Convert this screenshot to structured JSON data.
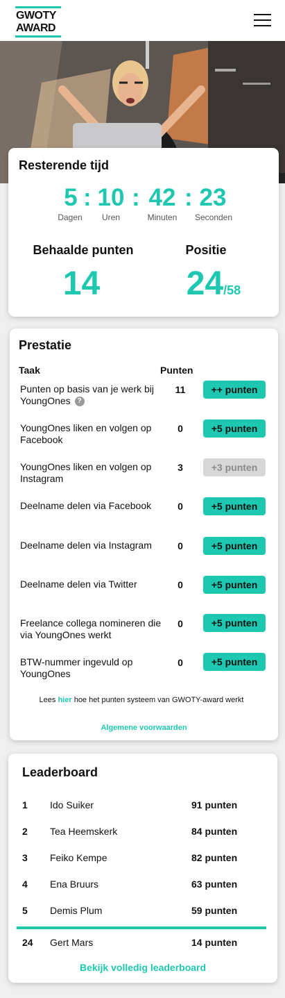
{
  "header": {
    "logo_line1": "GWOTY",
    "logo_line2": "AWARD",
    "menu_icon": "hamburger-icon"
  },
  "colors": {
    "accent": "#1ec8b0",
    "disabled": "#d7d7d7",
    "background": "#efefef"
  },
  "countdown": {
    "title": "Resterende tijd",
    "days": "5",
    "days_label": "Dagen",
    "hours": "10",
    "hours_label": "Uren",
    "minutes": "42",
    "minutes_label": "Minuten",
    "seconds": "23",
    "seconds_label": "Seconden",
    "separator": ":"
  },
  "stats": {
    "points_label": "Behaalde punten",
    "points_value": "14",
    "position_label": "Positie",
    "position_value": "24",
    "position_total": "/58"
  },
  "prestatie": {
    "title": "Prestatie",
    "col_task": "Taak",
    "col_points": "Punten",
    "help_icon": "question-circle-icon",
    "tasks": [
      {
        "label": "Punten op basis van je werk bij YoungOnes",
        "points": "11",
        "button": "++ punten",
        "enabled": true,
        "has_help": true
      },
      {
        "label": "YoungOnes liken en volgen op Facebook",
        "points": "0",
        "button": "+5 punten",
        "enabled": true
      },
      {
        "label": "YoungOnes liken en volgen op Instagram",
        "points": "3",
        "button": "+3 punten",
        "enabled": false
      },
      {
        "label": "Deelname delen via Facebook",
        "points": "0",
        "button": "+5 punten",
        "enabled": true
      },
      {
        "label": "Deelname delen via Instagram",
        "points": "0",
        "button": "+5 punten",
        "enabled": true
      },
      {
        "label": "Deelname delen via Twitter",
        "points": "0",
        "button": "+5 punten",
        "enabled": true
      },
      {
        "label": "Freelance collega nomineren die via YoungOnes werkt",
        "points": "0",
        "button": "+5 punten",
        "enabled": true
      },
      {
        "label": "BTW-nummer ingevuld op YoungOnes",
        "points": "0",
        "button": "+5 punten",
        "enabled": true
      }
    ],
    "footnote_before": "Lees ",
    "footnote_link": "hier",
    "footnote_after": " hoe het punten systeem van GWOTY-award werkt",
    "terms_link": "Algemene voorwaarden"
  },
  "leaderboard": {
    "title": "Leaderboard",
    "rows": [
      {
        "rank": "1",
        "name": "Ido Suiker",
        "points": "91 punten"
      },
      {
        "rank": "2",
        "name": "Tea Heemskerk",
        "points": "84 punten"
      },
      {
        "rank": "3",
        "name": "Feiko Kempe",
        "points": "82 punten"
      },
      {
        "rank": "4",
        "name": "Ena Bruurs",
        "points": "63 punten"
      },
      {
        "rank": "5",
        "name": "Demis Plum",
        "points": "59 punten"
      }
    ],
    "own": {
      "rank": "24",
      "name": "Gert Mars",
      "points": "14 punten"
    },
    "full_link": "Bekijk volledig leaderboard"
  }
}
